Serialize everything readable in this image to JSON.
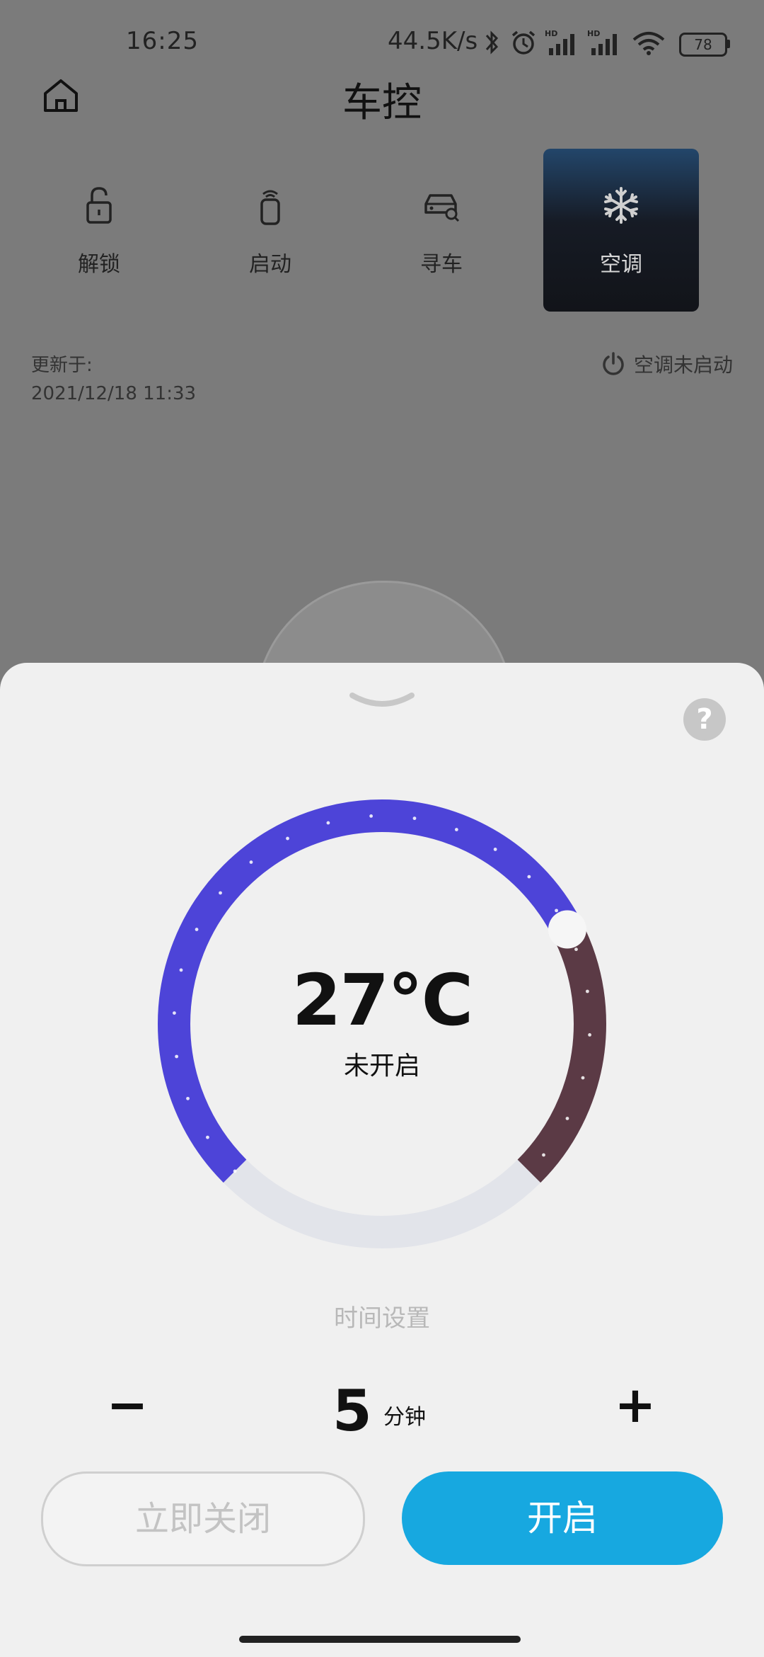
{
  "status_bar": {
    "time": "16:25",
    "network_speed": "44.5K/s",
    "battery": "78",
    "icons": [
      "bluetooth-icon",
      "alarm-icon",
      "signal-icon",
      "signal-icon",
      "wifi-icon",
      "battery-icon"
    ]
  },
  "header": {
    "title": "车控",
    "home_icon": "home-icon"
  },
  "controls": [
    {
      "label": "解锁",
      "icon": "unlock-icon",
      "active": false
    },
    {
      "label": "启动",
      "icon": "remote-start-icon",
      "active": false
    },
    {
      "label": "寻车",
      "icon": "find-car-icon",
      "active": false
    },
    {
      "label": "空调",
      "icon": "snowflake-icon",
      "active": true
    }
  ],
  "update_info": {
    "label": "更新于:",
    "timestamp": "2021/12/18 11:33"
  },
  "ac_status": {
    "text": "空调未启动",
    "icon": "power-icon"
  },
  "sheet": {
    "help_text": "?",
    "temperature": "27℃",
    "temperature_status": "未开启",
    "time_setting_label": "时间设置",
    "minus": "−",
    "plus": "+",
    "duration_value": "5",
    "duration_unit": "分钟",
    "close_button": "立即关闭",
    "open_button": "开启"
  },
  "colors": {
    "dial_cool": "#4d44d8",
    "dial_warm": "#5b3a45",
    "dial_track": "#e2e4ea",
    "accent": "#17a8e0"
  }
}
